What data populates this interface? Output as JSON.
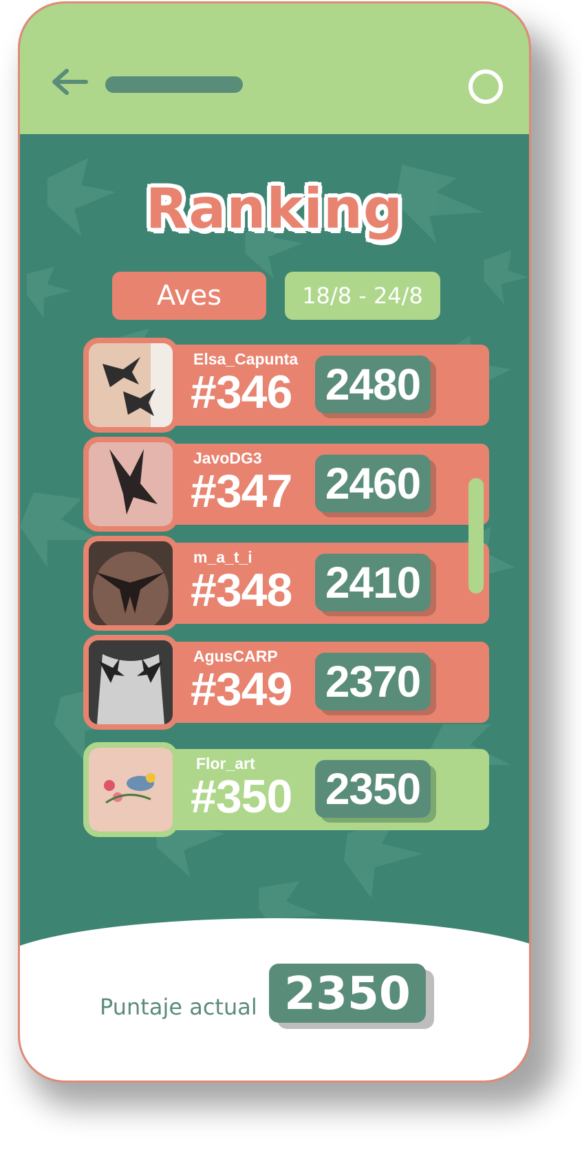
{
  "page": {
    "title": "Ranking"
  },
  "filters": {
    "category": "Aves",
    "date_range": "18/8 - 24/8"
  },
  "ranking": [
    {
      "user": "Elsa_Capunta",
      "rank": "#346",
      "score": "2480",
      "current_user": false,
      "image": "swallows tattoo on leg"
    },
    {
      "user": "JavoDG3",
      "rank": "#347",
      "score": "2460",
      "current_user": false,
      "image": "swallow tattoo"
    },
    {
      "user": "m_a_t_i",
      "rank": "#348",
      "score": "2410",
      "current_user": false,
      "image": "eagle tattoo on back"
    },
    {
      "user": "AgusCARP",
      "rank": "#349",
      "score": "2370",
      "current_user": false,
      "image": "swallows tattoo on chest"
    },
    {
      "user": "Flor_art",
      "rank": "#350",
      "score": "2350",
      "current_user": true,
      "image": "bird and flowers tattoo"
    }
  ],
  "footer": {
    "label": "Puntaje actual",
    "score": "2350"
  },
  "colors": {
    "header": "#aed78b",
    "background": "#3e8473",
    "accent": "#e8836f",
    "highlight": "#aed78b",
    "score_box": "#5a8c7a"
  }
}
